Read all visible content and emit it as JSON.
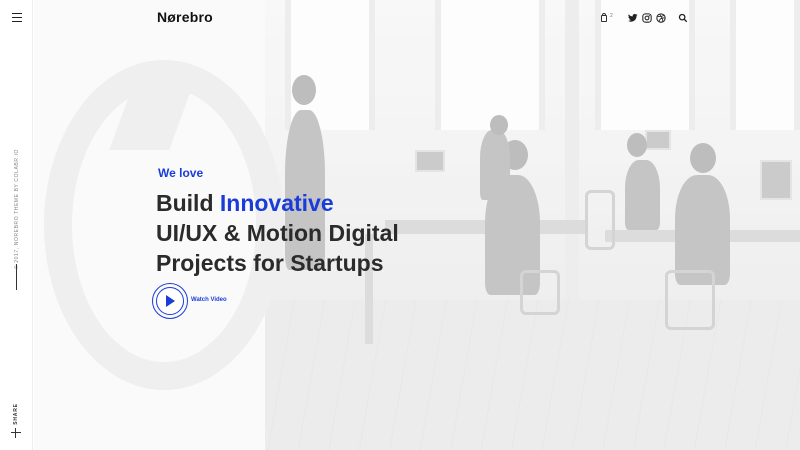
{
  "header": {
    "logo": "Nørebro",
    "cart_count": "2",
    "icons": [
      "menu-icon",
      "cart-icon",
      "twitter-icon",
      "instagram-icon",
      "dribbble-icon",
      "search-icon"
    ]
  },
  "sidebar": {
    "copyright": "© 2017, NOREBRO THEME BY COLABR.IO",
    "share_label": "SHARE"
  },
  "hero": {
    "eyebrow": "We love",
    "line1_plain": "Build ",
    "line1_accent": "Innovative",
    "line2": "UI/UX & Motion Digital",
    "line3": "Projects for Startups",
    "watch_label": "Watch Video"
  },
  "colors": {
    "accent": "#1a3cd8",
    "text": "#2b2b2b",
    "background": "#fafafa"
  }
}
